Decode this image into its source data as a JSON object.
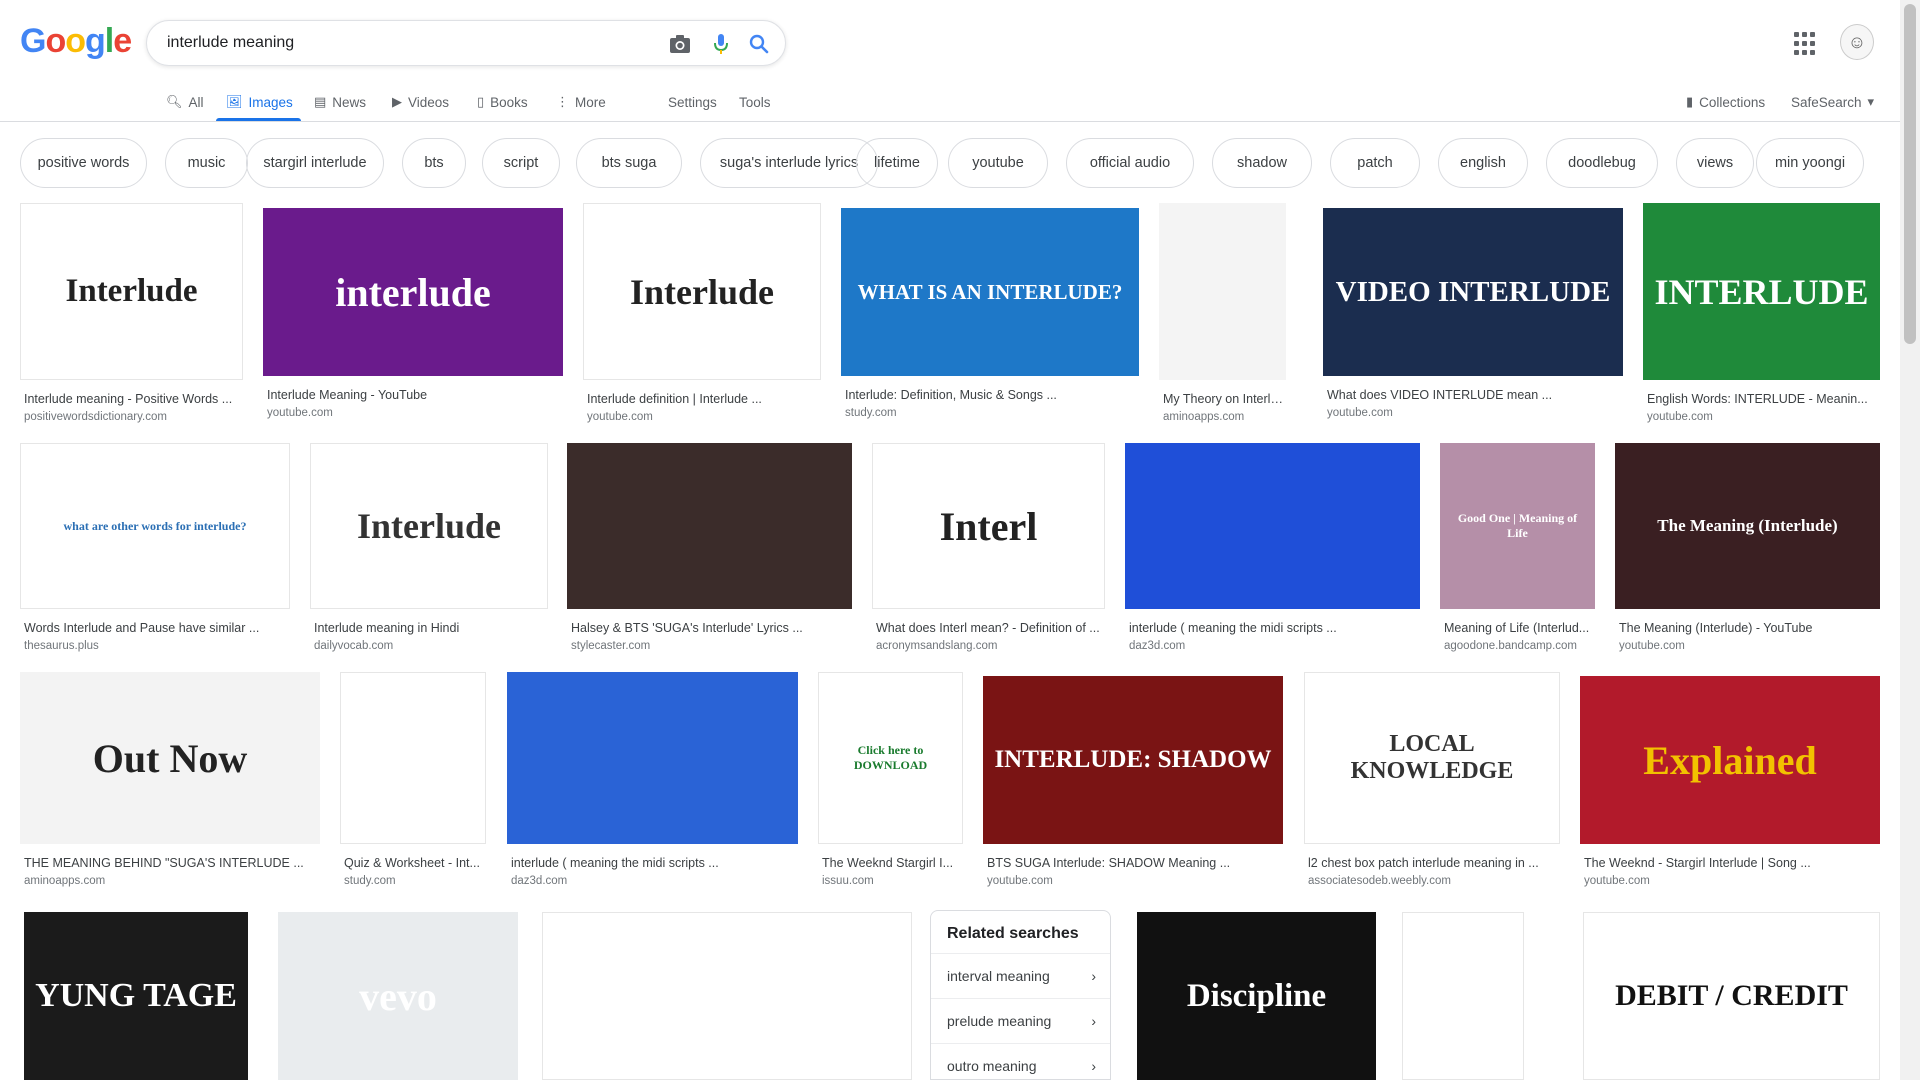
{
  "search": {
    "query": "interlude meaning"
  },
  "logo": {
    "letters": [
      "G",
      "o",
      "o",
      "g",
      "l",
      "e"
    ],
    "colors": [
      "#4285F4",
      "#EA4335",
      "#FBBC05",
      "#4285F4",
      "#34A853",
      "#EA4335"
    ]
  },
  "nav": {
    "all": "All",
    "images": "Images",
    "news": "News",
    "videos": "Videos",
    "books": "Books",
    "more": "More",
    "settings": "Settings",
    "tools": "Tools",
    "collections": "Collections",
    "safesearch": "SafeSearch"
  },
  "chips": [
    "positive words",
    "music",
    "stargirl interlude",
    "bts",
    "script",
    "bts suga",
    "suga's interlude lyrics",
    "lifetime",
    "youtube",
    "official audio",
    "shadow",
    "patch",
    "english",
    "doodlebug",
    "views",
    "min yoongi"
  ],
  "results": [
    {
      "title": "Interlude meaning - Positive Words ...",
      "source": "positivewordsdictionary.com",
      "thumb_text": "Interlude",
      "bg": "#ffffff",
      "fg": "#222"
    },
    {
      "title": "Interlude Meaning - YouTube",
      "source": "youtube.com",
      "thumb_text": "interlude",
      "bg": "#6a1b8c",
      "fg": "#ffffff"
    },
    {
      "title": "Interlude definition | Interlude ...",
      "source": "youtube.com",
      "thumb_text": "Interlude",
      "bg": "#ffffff",
      "fg": "#222"
    },
    {
      "title": "Interlude: Definition, Music & Songs ...",
      "source": "study.com",
      "thumb_text": "WHAT IS AN INTERLUDE?",
      "bg": "#1e78c8",
      "fg": "#ffffff"
    },
    {
      "title": "My Theory on Interlud...",
      "source": "aminoapps.com",
      "thumb_text": "",
      "bg": "#f4f4f4",
      "fg": "#333"
    },
    {
      "title": "What does VIDEO INTERLUDE mean ...",
      "source": "youtube.com",
      "thumb_text": "VIDEO INTERLUDE",
      "bg": "#1b2d4f",
      "fg": "#ffffff"
    },
    {
      "title": "English Words: INTERLUDE - Meanin...",
      "source": "youtube.com",
      "thumb_text": "INTERLUDE",
      "bg": "#1f8a3a",
      "fg": "#ffffff"
    },
    {
      "title": "Words Interlude and Pause have similar ...",
      "source": "thesaurus.plus",
      "thumb_text": "what are other words for interlude?",
      "bg": "#ffffff",
      "fg": "#2b6fb4"
    },
    {
      "title": "Interlude meaning in Hindi",
      "source": "dailyvocab.com",
      "thumb_text": "Interlude",
      "bg": "#ffffff",
      "fg": "#333"
    },
    {
      "title": "Halsey & BTS 'SUGA's Interlude' Lyrics ...",
      "source": "stylecaster.com",
      "thumb_text": "",
      "bg": "#3b2c2a",
      "fg": "#fff"
    },
    {
      "title": "What does Interl mean? - Definition of ...",
      "source": "acronymsandslang.com",
      "thumb_text": "Interl",
      "bg": "#ffffff",
      "fg": "#222"
    },
    {
      "title": "interlude ( meaning the midi scripts ...",
      "source": "daz3d.com",
      "thumb_text": "",
      "bg": "#1f4fd8",
      "fg": "#fff"
    },
    {
      "title": "Meaning of Life (Interlud...",
      "source": "agoodone.bandcamp.com",
      "thumb_text": "Good One | Meaning of Life",
      "bg": "#b58fa8",
      "fg": "#fff"
    },
    {
      "title": "The Meaning (Interlude) - YouTube",
      "source": "youtube.com",
      "thumb_text": "The Meaning (Interlude)",
      "bg": "#3a1f22",
      "fg": "#fff"
    },
    {
      "title": "THE MEANING BEHIND \"SUGA'S INTERLUDE ...",
      "source": "aminoapps.com",
      "thumb_text": "Out Now",
      "bg": "#f3f3f3",
      "fg": "#222"
    },
    {
      "title": "Quiz & Worksheet - Int...",
      "source": "study.com",
      "thumb_text": "",
      "bg": "#ffffff",
      "fg": "#333"
    },
    {
      "title": "interlude ( meaning the midi scripts ...",
      "source": "daz3d.com",
      "thumb_text": "",
      "bg": "#2a63d6",
      "fg": "#fff"
    },
    {
      "title": "The Weeknd Stargirl I...",
      "source": "issuu.com",
      "thumb_text": "Click here to DOWNLOAD",
      "bg": "#ffffff",
      "fg": "#1a7b2e"
    },
    {
      "title": "BTS SUGA Interlude: SHADOW Meaning ...",
      "source": "youtube.com",
      "thumb_text": "INTERLUDE: SHADOW",
      "bg": "#7a1414",
      "fg": "#fff"
    },
    {
      "title": "l2 chest box patch interlude meaning in ...",
      "source": "associatesodeb.weebly.com",
      "thumb_text": "LOCAL KNOWLEDGE",
      "bg": "#ffffff",
      "fg": "#333"
    },
    {
      "title": "The Weeknd - Stargirl Interlude | Song ...",
      "source": "youtube.com",
      "thumb_text": "Explained",
      "bg": "#b21a2b",
      "fg": "#f2c200"
    },
    {
      "title": "",
      "source": "",
      "thumb_text": "YUNG TAGE",
      "bg": "#1b1b1b",
      "fg": "#ffffff"
    },
    {
      "title": "",
      "source": "",
      "thumb_text": "vevo",
      "bg": "#e9ecee",
      "fg": "#fff"
    },
    {
      "title": "",
      "source": "",
      "thumb_text": "",
      "bg": "#ffffff",
      "fg": "#333"
    },
    {
      "title": "",
      "source": "",
      "thumb_text": "Discipline",
      "bg": "#111111",
      "fg": "#ffffff"
    },
    {
      "title": "",
      "source": "",
      "thumb_text": "",
      "bg": "#ffffff",
      "fg": "#333"
    },
    {
      "title": "",
      "source": "",
      "thumb_text": "DEBIT / CREDIT",
      "bg": "#ffffff",
      "fg": "#111"
    }
  ],
  "related": {
    "heading": "Related searches",
    "items": [
      "interval meaning",
      "prelude meaning",
      "outro meaning"
    ]
  }
}
